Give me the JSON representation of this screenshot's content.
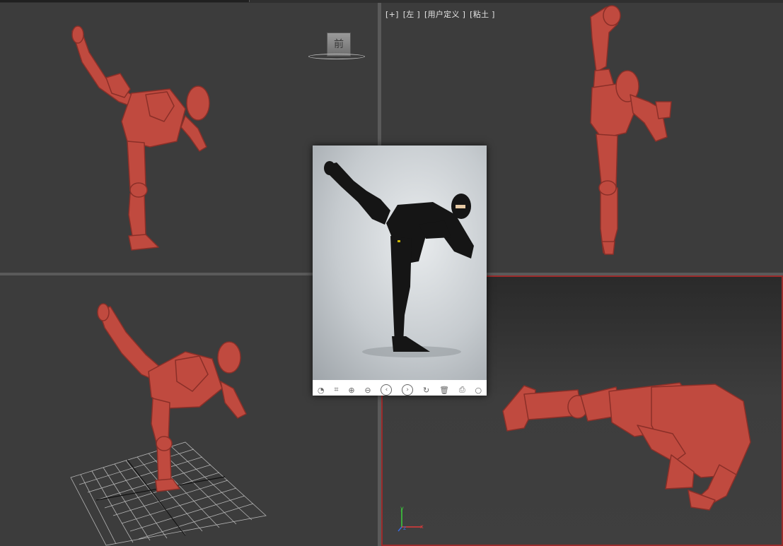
{
  "viewports": {
    "top_left": {
      "label": ""
    },
    "top_right": {
      "labels": [
        "[+]",
        "[左 ]",
        "[用户定义 ]",
        "[粘土 ]"
      ]
    },
    "bottom_left": {
      "label": ""
    },
    "bottom_right": {
      "label": ""
    }
  },
  "viewcube": {
    "face_label": "前"
  },
  "colors": {
    "figure": "#c04a3f",
    "viewport_bg": "#3c3c3c",
    "active_border": "#9b2a2a",
    "grid": "#b5b5b5"
  },
  "photo_viewer": {
    "toolbar_icons": [
      "rotate-left-icon",
      "crop-icon",
      "zoom-in-icon",
      "zoom-out-icon",
      "prev-icon",
      "next-icon",
      "rotate-icon",
      "delete-icon",
      "print-icon",
      "more-icon"
    ]
  },
  "axis_gizmo": {
    "x_label": "x",
    "y_label": "y",
    "z_label": "z"
  }
}
